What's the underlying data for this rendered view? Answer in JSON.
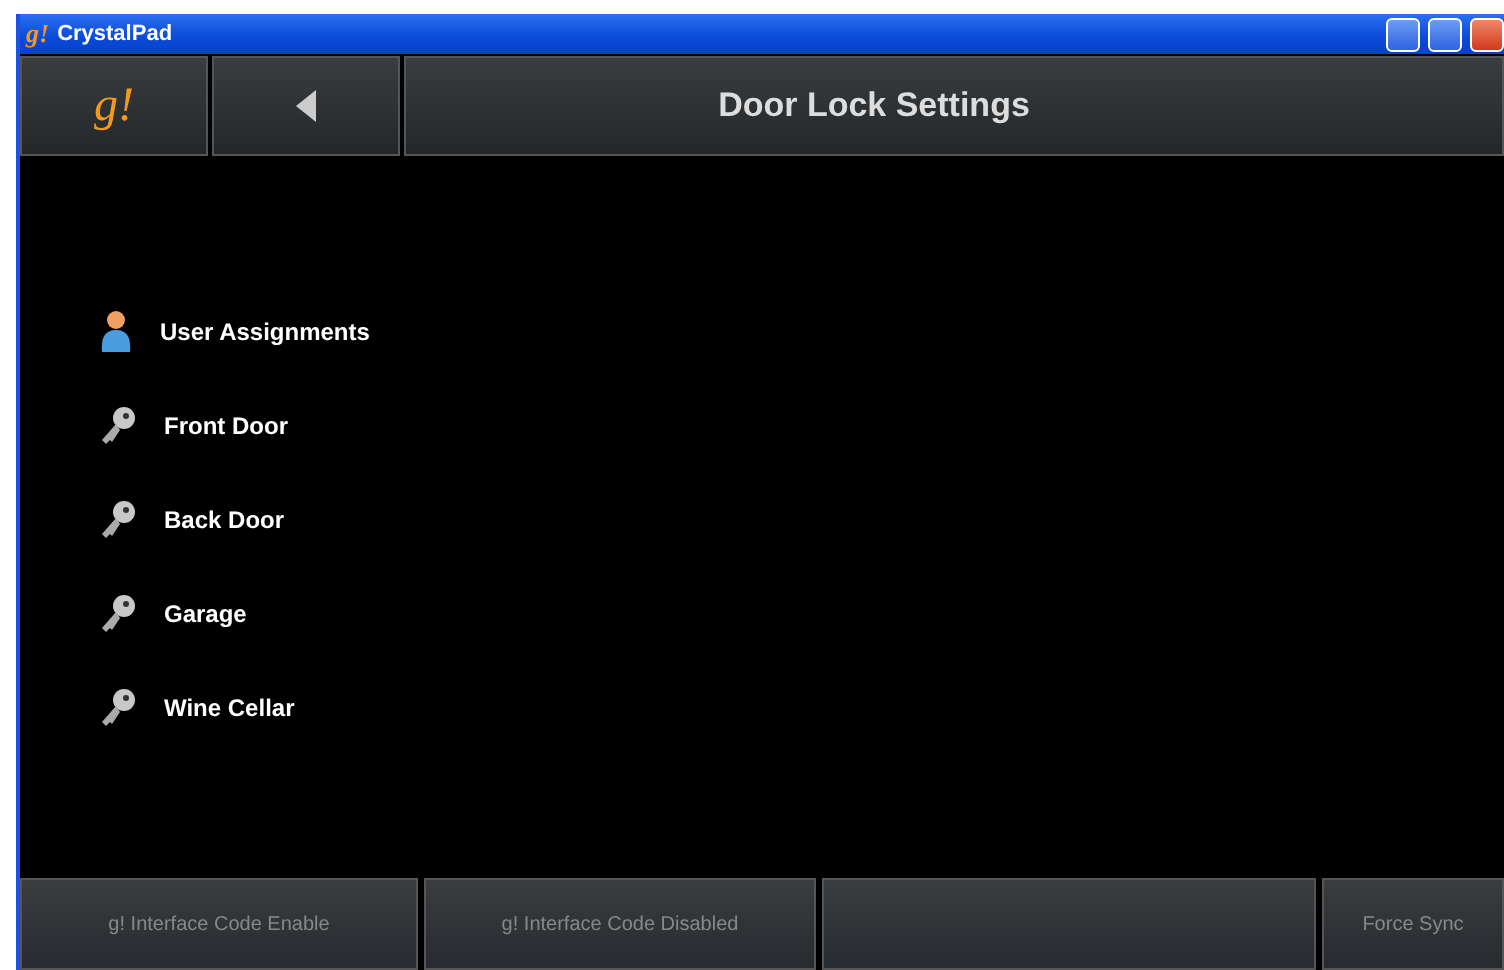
{
  "window": {
    "logo": "g!",
    "title": "CrystalPad"
  },
  "header": {
    "logo": "g!",
    "title": "Door Lock Settings"
  },
  "items": [
    {
      "kind": "user",
      "label": "User Assignments"
    },
    {
      "kind": "key",
      "label": "Front Door"
    },
    {
      "kind": "key",
      "label": "Back Door"
    },
    {
      "kind": "key",
      "label": "Garage"
    },
    {
      "kind": "key",
      "label": "Wine Cellar"
    }
  ],
  "footer_buttons": [
    {
      "kind": "text",
      "label": "g! Interface Code Enable"
    },
    {
      "kind": "text",
      "label": "g! Interface Code Disabled"
    },
    {
      "kind": "blank"
    },
    {
      "kind": "text",
      "label": "Force Sync"
    }
  ]
}
